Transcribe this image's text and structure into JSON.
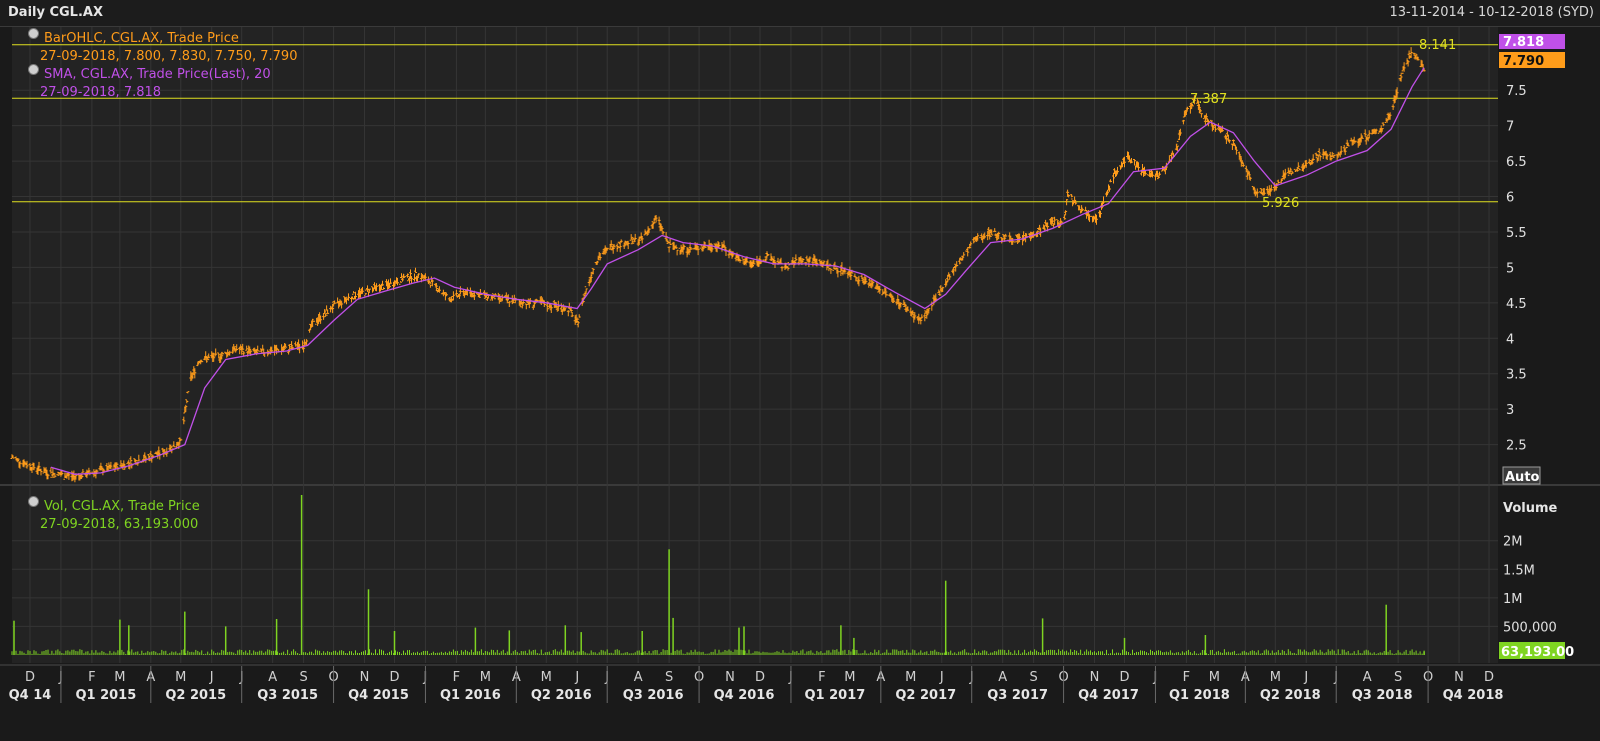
{
  "header": {
    "title": "Daily CGL.AX",
    "date_range": "13-11-2014 - 10-12-2018 (SYD)"
  },
  "legend": {
    "ohlc_name": "BarOHLC, CGL.AX, Trade Price",
    "ohlc_values": "27-09-2018, 7.800, 7.830, 7.750, 7.790",
    "sma_name": "SMA, CGL.AX, Trade Price(Last),  20",
    "sma_values": "27-09-2018, 7.818",
    "vol_name": "Vol, CGL.AX, Trade Price",
    "vol_values": "27-09-2018, 63,193.000"
  },
  "colors": {
    "background": "#1a1a1a",
    "panel": "#232323",
    "grid": "#353535",
    "price": "#ff9c1a",
    "sma": "#c050e8",
    "volume": "#7fd421",
    "levels": "#e0e020",
    "price_badge": "#ff9c1a",
    "sma_badge": "#c050e8",
    "volume_badge": "#7fd421"
  },
  "chart_data": {
    "type": "line",
    "title": "Daily CGL.AX",
    "price_axis": {
      "ylim": [
        2.0,
        8.35
      ],
      "ticks": [
        2.5,
        3,
        3.5,
        4,
        4.5,
        5,
        5.5,
        6,
        6.5,
        7,
        7.5
      ],
      "tick_labels": [
        "2.5",
        "3",
        "3.5",
        "4",
        "4.5",
        "5",
        "5.5",
        "6",
        "6.5",
        "7",
        "7.5"
      ],
      "scale_button": "Auto"
    },
    "volume_axis": {
      "title": "Volume",
      "ylim": [
        0,
        2800000
      ],
      "ticks": [
        500000,
        1000000,
        1500000,
        2000000
      ],
      "tick_labels": [
        "500,000",
        "1M",
        "1.5M",
        "2M"
      ],
      "scale_button": "Auto"
    },
    "x_axis": {
      "start": "2014-11-13",
      "end": "2018-12-10",
      "month_ticks": [
        {
          "date": "2014-12-01",
          "label": "D"
        },
        {
          "date": "2015-01-01",
          "label": "J"
        },
        {
          "date": "2015-02-01",
          "label": "F"
        },
        {
          "date": "2015-03-01",
          "label": "M"
        },
        {
          "date": "2015-04-01",
          "label": "A"
        },
        {
          "date": "2015-05-01",
          "label": "M"
        },
        {
          "date": "2015-06-01",
          "label": "J"
        },
        {
          "date": "2015-07-01",
          "label": "J"
        },
        {
          "date": "2015-08-01",
          "label": "A"
        },
        {
          "date": "2015-09-01",
          "label": "S"
        },
        {
          "date": "2015-10-01",
          "label": "O"
        },
        {
          "date": "2015-11-01",
          "label": "N"
        },
        {
          "date": "2015-12-01",
          "label": "D"
        },
        {
          "date": "2016-01-01",
          "label": "J"
        },
        {
          "date": "2016-02-01",
          "label": "F"
        },
        {
          "date": "2016-03-01",
          "label": "M"
        },
        {
          "date": "2016-04-01",
          "label": "A"
        },
        {
          "date": "2016-05-01",
          "label": "M"
        },
        {
          "date": "2016-06-01",
          "label": "J"
        },
        {
          "date": "2016-07-01",
          "label": "J"
        },
        {
          "date": "2016-08-01",
          "label": "A"
        },
        {
          "date": "2016-09-01",
          "label": "S"
        },
        {
          "date": "2016-10-01",
          "label": "O"
        },
        {
          "date": "2016-11-01",
          "label": "N"
        },
        {
          "date": "2016-12-01",
          "label": "D"
        },
        {
          "date": "2017-01-01",
          "label": "J"
        },
        {
          "date": "2017-02-01",
          "label": "F"
        },
        {
          "date": "2017-03-01",
          "label": "M"
        },
        {
          "date": "2017-04-01",
          "label": "A"
        },
        {
          "date": "2017-05-01",
          "label": "M"
        },
        {
          "date": "2017-06-01",
          "label": "J"
        },
        {
          "date": "2017-07-01",
          "label": "J"
        },
        {
          "date": "2017-08-01",
          "label": "A"
        },
        {
          "date": "2017-09-01",
          "label": "S"
        },
        {
          "date": "2017-10-01",
          "label": "O"
        },
        {
          "date": "2017-11-01",
          "label": "N"
        },
        {
          "date": "2017-12-01",
          "label": "D"
        },
        {
          "date": "2018-01-01",
          "label": "J"
        },
        {
          "date": "2018-02-01",
          "label": "F"
        },
        {
          "date": "2018-03-01",
          "label": "M"
        },
        {
          "date": "2018-04-01",
          "label": "A"
        },
        {
          "date": "2018-05-01",
          "label": "M"
        },
        {
          "date": "2018-06-01",
          "label": "J"
        },
        {
          "date": "2018-07-01",
          "label": "J"
        },
        {
          "date": "2018-08-01",
          "label": "A"
        },
        {
          "date": "2018-09-01",
          "label": "S"
        },
        {
          "date": "2018-10-01",
          "label": "O"
        },
        {
          "date": "2018-11-01",
          "label": "N"
        },
        {
          "date": "2018-12-01",
          "label": "D"
        }
      ],
      "quarter_labels": [
        {
          "date": "2014-12-01",
          "label": "Q4 14"
        },
        {
          "date": "2015-02-15",
          "label": "Q1 2015"
        },
        {
          "date": "2015-05-16",
          "label": "Q2 2015"
        },
        {
          "date": "2015-08-16",
          "label": "Q3 2015"
        },
        {
          "date": "2015-11-15",
          "label": "Q4 2015"
        },
        {
          "date": "2016-02-15",
          "label": "Q1 2016"
        },
        {
          "date": "2016-05-16",
          "label": "Q2 2016"
        },
        {
          "date": "2016-08-16",
          "label": "Q3 2016"
        },
        {
          "date": "2016-11-15",
          "label": "Q4 2016"
        },
        {
          "date": "2017-02-14",
          "label": "Q1 2017"
        },
        {
          "date": "2017-05-16",
          "label": "Q2 2017"
        },
        {
          "date": "2017-08-16",
          "label": "Q3 2017"
        },
        {
          "date": "2017-11-15",
          "label": "Q4 2017"
        },
        {
          "date": "2018-02-14",
          "label": "Q1 2018"
        },
        {
          "date": "2018-05-16",
          "label": "Q2 2018"
        },
        {
          "date": "2018-08-16",
          "label": "Q3 2018"
        },
        {
          "date": "2018-11-15",
          "label": "Q4 2018"
        }
      ],
      "quarter_boundaries": [
        "2015-01-01",
        "2015-04-01",
        "2015-07-01",
        "2015-10-01",
        "2016-01-01",
        "2016-04-01",
        "2016-07-01",
        "2016-10-01",
        "2017-01-01",
        "2017-04-01",
        "2017-07-01",
        "2017-10-01",
        "2018-01-01",
        "2018-04-01",
        "2018-07-01",
        "2018-10-01"
      ]
    },
    "price_series": {
      "name": "BarOHLC, CGL.AX, Trade Price",
      "points": [
        [
          "2014-11-13",
          2.32
        ],
        [
          "2014-12-01",
          2.2
        ],
        [
          "2014-12-20",
          2.1
        ],
        [
          "2015-01-15",
          2.05
        ],
        [
          "2015-02-05",
          2.12
        ],
        [
          "2015-03-01",
          2.2
        ],
        [
          "2015-03-25",
          2.3
        ],
        [
          "2015-04-15",
          2.4
        ],
        [
          "2015-05-01",
          2.55
        ],
        [
          "2015-05-10",
          3.4
        ],
        [
          "2015-05-20",
          3.7
        ],
        [
          "2015-06-10",
          3.75
        ],
        [
          "2015-06-25",
          3.85
        ],
        [
          "2015-07-15",
          3.8
        ],
        [
          "2015-08-15",
          3.85
        ],
        [
          "2015-09-01",
          3.9
        ],
        [
          "2015-09-10",
          4.2
        ],
        [
          "2015-10-01",
          4.45
        ],
        [
          "2015-10-20",
          4.6
        ],
        [
          "2015-11-10",
          4.7
        ],
        [
          "2015-11-25",
          4.75
        ],
        [
          "2015-12-10",
          4.85
        ],
        [
          "2015-12-25",
          4.9
        ],
        [
          "2016-01-10",
          4.75
        ],
        [
          "2016-01-25",
          4.55
        ],
        [
          "2016-02-10",
          4.65
        ],
        [
          "2016-03-01",
          4.6
        ],
        [
          "2016-03-20",
          4.55
        ],
        [
          "2016-04-10",
          4.5
        ],
        [
          "2016-04-25",
          4.5
        ],
        [
          "2016-05-10",
          4.45
        ],
        [
          "2016-05-25",
          4.4
        ],
        [
          "2016-06-01",
          4.2
        ],
        [
          "2016-06-08",
          4.6
        ],
        [
          "2016-06-20",
          5.1
        ],
        [
          "2016-07-05",
          5.3
        ],
        [
          "2016-07-20",
          5.35
        ],
        [
          "2016-08-05",
          5.4
        ],
        [
          "2016-08-20",
          5.7
        ],
        [
          "2016-09-01",
          5.3
        ],
        [
          "2016-09-20",
          5.25
        ],
        [
          "2016-10-10",
          5.3
        ],
        [
          "2016-10-25",
          5.3
        ],
        [
          "2016-11-10",
          5.1
        ],
        [
          "2016-11-25",
          5.05
        ],
        [
          "2016-12-10",
          5.15
        ],
        [
          "2016-12-25",
          5.0
        ],
        [
          "2017-01-10",
          5.1
        ],
        [
          "2017-01-25",
          5.1
        ],
        [
          "2017-02-10",
          5.0
        ],
        [
          "2017-02-25",
          4.95
        ],
        [
          "2017-03-10",
          4.85
        ],
        [
          "2017-03-25",
          4.75
        ],
        [
          "2017-04-10",
          4.6
        ],
        [
          "2017-04-25",
          4.45
        ],
        [
          "2017-05-10",
          4.25
        ],
        [
          "2017-05-20",
          4.4
        ],
        [
          "2017-06-05",
          4.8
        ],
        [
          "2017-06-20",
          5.1
        ],
        [
          "2017-07-05",
          5.4
        ],
        [
          "2017-07-20",
          5.5
        ],
        [
          "2017-08-05",
          5.4
        ],
        [
          "2017-08-20",
          5.4
        ],
        [
          "2017-09-05",
          5.5
        ],
        [
          "2017-09-20",
          5.65
        ],
        [
          "2017-10-01",
          5.6
        ],
        [
          "2017-10-05",
          6.05
        ],
        [
          "2017-10-20",
          5.8
        ],
        [
          "2017-11-05",
          5.7
        ],
        [
          "2017-11-20",
          6.3
        ],
        [
          "2017-12-05",
          6.55
        ],
        [
          "2017-12-20",
          6.35
        ],
        [
          "2018-01-05",
          6.3
        ],
        [
          "2018-01-20",
          6.6
        ],
        [
          "2018-02-01",
          7.2
        ],
        [
          "2018-02-10",
          7.35
        ],
        [
          "2018-02-20",
          7.1
        ],
        [
          "2018-03-05",
          6.95
        ],
        [
          "2018-03-20",
          6.75
        ],
        [
          "2018-04-01",
          6.4
        ],
        [
          "2018-04-10",
          6.1
        ],
        [
          "2018-04-20",
          6.05
        ],
        [
          "2018-05-01",
          6.15
        ],
        [
          "2018-05-15",
          6.35
        ],
        [
          "2018-06-01",
          6.45
        ],
        [
          "2018-06-15",
          6.6
        ],
        [
          "2018-07-01",
          6.55
        ],
        [
          "2018-07-15",
          6.75
        ],
        [
          "2018-08-01",
          6.85
        ],
        [
          "2018-08-15",
          6.95
        ],
        [
          "2018-08-25",
          7.2
        ],
        [
          "2018-09-05",
          7.75
        ],
        [
          "2018-09-15",
          8.05
        ],
        [
          "2018-09-22",
          7.9
        ],
        [
          "2018-09-27",
          7.79
        ]
      ]
    },
    "sma_series": {
      "name": "SMA, CGL.AX, Trade Price(Last),  20",
      "points": [
        [
          "2014-12-22",
          2.18
        ],
        [
          "2015-01-15",
          2.08
        ],
        [
          "2015-02-10",
          2.1
        ],
        [
          "2015-03-10",
          2.2
        ],
        [
          "2015-04-10",
          2.35
        ],
        [
          "2015-05-05",
          2.5
        ],
        [
          "2015-05-25",
          3.3
        ],
        [
          "2015-06-15",
          3.7
        ],
        [
          "2015-07-15",
          3.78
        ],
        [
          "2015-08-15",
          3.82
        ],
        [
          "2015-09-05",
          3.9
        ],
        [
          "2015-10-01",
          4.25
        ],
        [
          "2015-10-25",
          4.55
        ],
        [
          "2015-11-25",
          4.68
        ],
        [
          "2015-12-20",
          4.78
        ],
        [
          "2016-01-10",
          4.85
        ],
        [
          "2016-01-30",
          4.72
        ],
        [
          "2016-03-01",
          4.62
        ],
        [
          "2016-04-01",
          4.55
        ],
        [
          "2016-05-01",
          4.5
        ],
        [
          "2016-06-01",
          4.42
        ],
        [
          "2016-06-15",
          4.7
        ],
        [
          "2016-07-01",
          5.05
        ],
        [
          "2016-08-01",
          5.25
        ],
        [
          "2016-08-25",
          5.45
        ],
        [
          "2016-09-15",
          5.35
        ],
        [
          "2016-10-15",
          5.3
        ],
        [
          "2016-11-15",
          5.15
        ],
        [
          "2016-12-15",
          5.05
        ],
        [
          "2017-01-15",
          5.05
        ],
        [
          "2017-02-15",
          5.02
        ],
        [
          "2017-03-15",
          4.9
        ],
        [
          "2017-04-15",
          4.65
        ],
        [
          "2017-05-15",
          4.42
        ],
        [
          "2017-06-05",
          4.62
        ],
        [
          "2017-06-25",
          4.95
        ],
        [
          "2017-07-20",
          5.35
        ],
        [
          "2017-08-20",
          5.4
        ],
        [
          "2017-09-20",
          5.55
        ],
        [
          "2017-10-20",
          5.75
        ],
        [
          "2017-11-15",
          5.9
        ],
        [
          "2017-12-10",
          6.35
        ],
        [
          "2018-01-10",
          6.4
        ],
        [
          "2018-02-05",
          6.85
        ],
        [
          "2018-02-25",
          7.05
        ],
        [
          "2018-03-20",
          6.9
        ],
        [
          "2018-04-10",
          6.5
        ],
        [
          "2018-05-01",
          6.15
        ],
        [
          "2018-06-01",
          6.3
        ],
        [
          "2018-07-01",
          6.5
        ],
        [
          "2018-08-01",
          6.65
        ],
        [
          "2018-08-25",
          6.95
        ],
        [
          "2018-09-15",
          7.55
        ],
        [
          "2018-09-27",
          7.818
        ]
      ]
    },
    "volume_series": {
      "name": "Vol, CGL.AX, Trade Price",
      "spikes": [
        [
          "2014-11-15",
          600000
        ],
        [
          "2015-03-01",
          620000
        ],
        [
          "2015-03-10",
          520000
        ],
        [
          "2015-05-05",
          760000
        ],
        [
          "2015-06-15",
          500000
        ],
        [
          "2015-08-05",
          630000
        ],
        [
          "2015-08-30",
          2800000
        ],
        [
          "2015-11-05",
          1150000
        ],
        [
          "2015-12-01",
          420000
        ],
        [
          "2016-02-20",
          480000
        ],
        [
          "2016-03-25",
          430000
        ],
        [
          "2016-05-20",
          520000
        ],
        [
          "2016-06-05",
          400000
        ],
        [
          "2016-08-05",
          420000
        ],
        [
          "2016-09-01",
          1850000
        ],
        [
          "2016-09-05",
          650000
        ],
        [
          "2016-11-10",
          480000
        ],
        [
          "2016-11-15",
          500000
        ],
        [
          "2017-02-20",
          520000
        ],
        [
          "2017-03-05",
          300000
        ],
        [
          "2017-06-05",
          1300000
        ],
        [
          "2017-09-10",
          640000
        ],
        [
          "2017-12-01",
          300000
        ],
        [
          "2018-02-20",
          350000
        ],
        [
          "2018-08-20",
          880000
        ],
        [
          "2018-09-27",
          63193
        ]
      ],
      "baseline": 60000
    },
    "annotations": {
      "levels": [
        {
          "value": 8.141,
          "label": "8.141",
          "from": "2014-11-13"
        },
        {
          "value": 7.387,
          "label": "7.387",
          "from": "2014-11-13"
        },
        {
          "value": 5.926,
          "label": "5.926",
          "from": "2014-11-13"
        }
      ],
      "sma_badge": "7.818",
      "price_badge": "7.790",
      "volume_badge": "63,193.00"
    }
  }
}
